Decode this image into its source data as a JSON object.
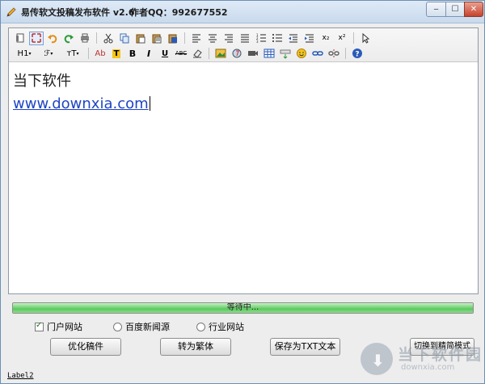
{
  "window": {
    "title": "易传软文投稿发布软件 v2.6",
    "author": "作者QQ：992677552",
    "min_label": "‒",
    "max_label": "☐",
    "close_label": "✕"
  },
  "toolbar": {
    "heading_label": "H1",
    "font_label": "ℱ",
    "size_label": "тT",
    "ab_label": "Ab",
    "bold_label": "B",
    "italic_label": "I",
    "underline_label": "U",
    "strike_label": "ABC",
    "sub_label": "x₂",
    "sup_label": "x²"
  },
  "editor": {
    "line1": "当下软件",
    "link": "www.downxia.com"
  },
  "progress": {
    "status": "等待中...",
    "fraction": 1.0
  },
  "options": {
    "portal": {
      "label": "门户网站",
      "checked": true
    },
    "baidu": {
      "label": "百度新闻源",
      "selected": false
    },
    "industry": {
      "label": "行业网站",
      "selected": false
    }
  },
  "buttons": {
    "optimize": "优化稿件",
    "traditional": "转为繁体",
    "save_txt": "保存为TXT文本",
    "switch_mode": "切换到精简模式"
  },
  "status_label": "Label2",
  "watermark": {
    "title": "当下软件园",
    "subtitle": "downxia.com"
  },
  "colors": {
    "progress": "#5cc95f",
    "link": "#1f45c4",
    "titlebar": "#c9daee"
  }
}
